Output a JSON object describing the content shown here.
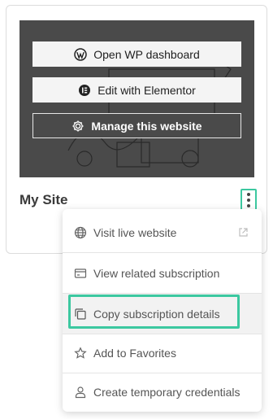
{
  "site": {
    "title": "My Site"
  },
  "preview": {
    "buttons": [
      {
        "label": "Open WP dashboard",
        "icon": "wordpress-icon"
      },
      {
        "label": "Edit with Elementor",
        "icon": "elementor-icon"
      },
      {
        "label": "Manage this website",
        "icon": "gear-icon"
      }
    ]
  },
  "menu": {
    "items": [
      {
        "label": "Visit live website",
        "icon": "globe-icon",
        "trailing_icon": "external-link-icon"
      },
      {
        "label": "View related subscription",
        "icon": "card-icon"
      },
      {
        "label": "Copy subscription details",
        "icon": "copy-icon"
      },
      {
        "label": "Add to Favorites",
        "icon": "star-icon"
      },
      {
        "label": "Create temporary credentials",
        "icon": "user-icon"
      }
    ]
  },
  "colors": {
    "highlight": "#3cc8a0",
    "preview_bg": "#4a4a4a"
  }
}
